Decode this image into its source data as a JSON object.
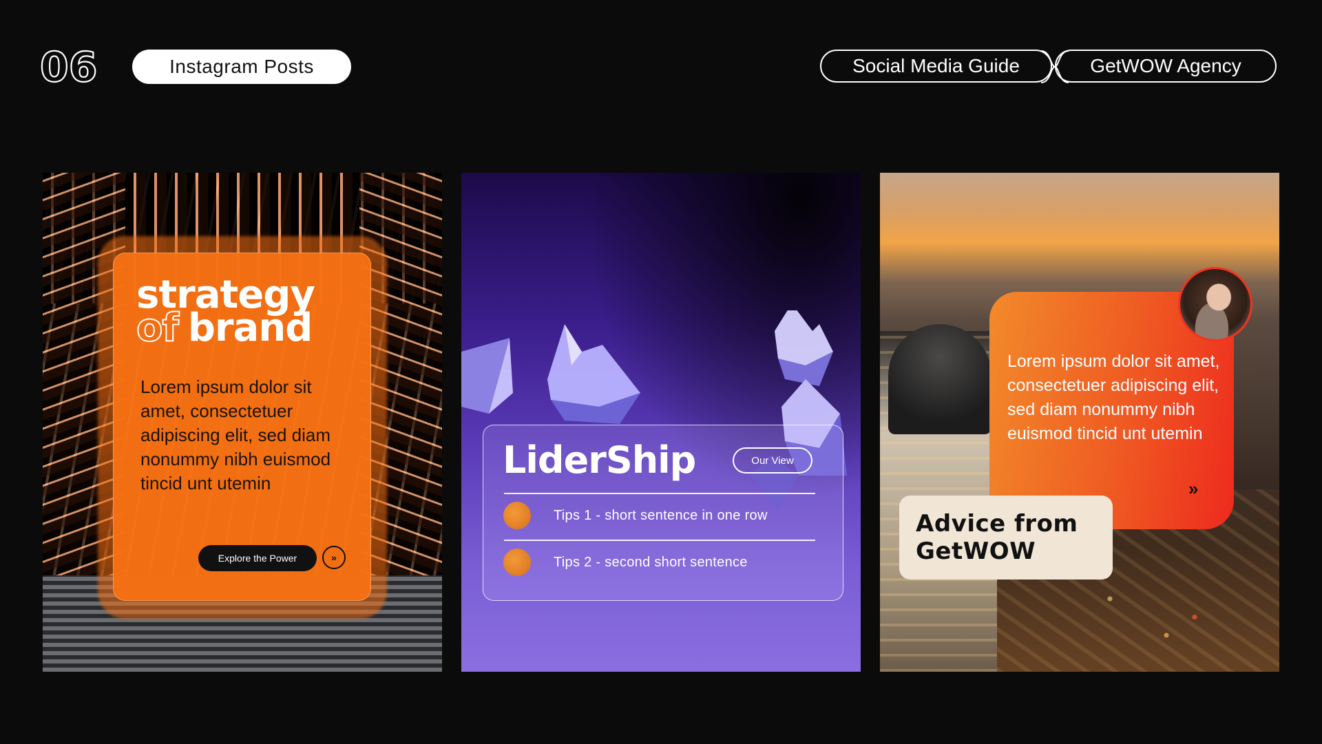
{
  "header": {
    "section_number": "06",
    "section_title": "Instagram Posts",
    "guide_label": "Social Media Guide",
    "agency_label": "GetWOW Agency"
  },
  "card1": {
    "title_line1": "strategy",
    "title_of": "of",
    "title_brand": "brand",
    "body": "Lorem ipsum dolor sit amet, consectetuer adipiscing elit, sed diam nonummy nibh euismod tincid unt utemin",
    "button_label": "Explore the Power",
    "accent": "#f67014"
  },
  "card2": {
    "title": "LiderShip",
    "pill_label": "Our View",
    "tips": [
      "Tips 1 - short sentence in one row",
      "Tips 2 - second short sentence"
    ],
    "accent": "#7b5ed6"
  },
  "card3": {
    "body": "Lorem ipsum dolor sit amet, consectetuer adipiscing elit, sed diam nonummy nibh euismod tincid unt utemin",
    "advice_title": "Advice from GetWOW",
    "accent": "#ef5a22"
  },
  "icons": {
    "explore_arrow": "double-chevron-right-icon",
    "card3_arrow": "double-chevron-right-icon"
  }
}
